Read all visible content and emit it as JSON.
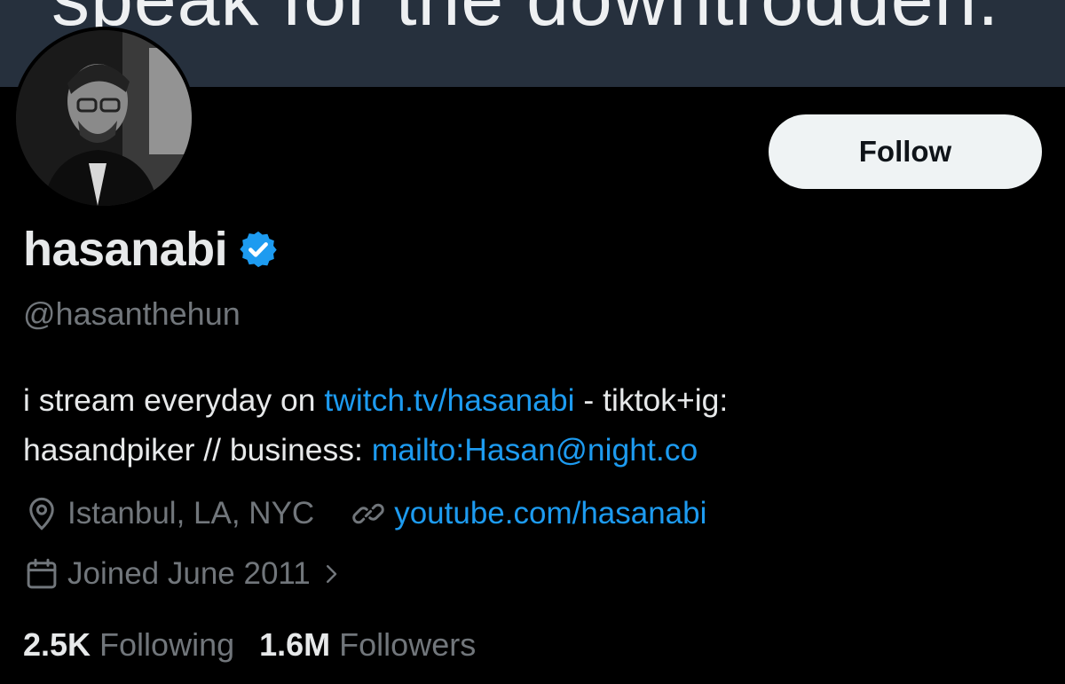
{
  "banner": {
    "text": "speak for the downtrodden."
  },
  "profile": {
    "follow_label": "Follow",
    "display_name": "hasanabi",
    "handle": "@hasanthehun",
    "bio": {
      "text1": "i stream everyday on ",
      "link1": "twitch.tv/hasanabi",
      "text2": " - tiktok+ig:",
      "text3": "hasandpiker // business: ",
      "link2": "mailto:Hasan@night.co"
    },
    "location": "Istanbul, LA, NYC",
    "website": "youtube.com/hasanabi",
    "joined": "Joined June 2011"
  },
  "stats": {
    "following_count": "2.5K",
    "following_label": "Following",
    "followers_count": "1.6M",
    "followers_label": "Followers"
  },
  "colors": {
    "accent": "#1d9bf0",
    "muted": "#71767b",
    "banner": "#26303d"
  }
}
